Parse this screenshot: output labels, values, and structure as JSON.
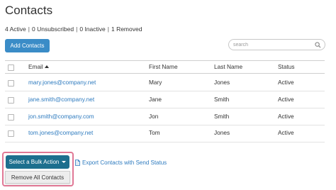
{
  "page": {
    "title": "Contacts"
  },
  "summary": [
    {
      "count": "4",
      "label": "Active"
    },
    {
      "count": "0",
      "label": "Unsubscribed"
    },
    {
      "count": "0",
      "label": "Inactive"
    },
    {
      "count": "1",
      "label": "Removed"
    }
  ],
  "toolbar": {
    "add_label": "Add Contacts",
    "search_placeholder": "search",
    "search_icon": "search-icon"
  },
  "table": {
    "headers": {
      "email": "Email",
      "first_name": "First Name",
      "last_name": "Last Name",
      "status": "Status"
    },
    "sort": {
      "column": "email",
      "direction": "ascending"
    },
    "rows": [
      {
        "email": "mary.jones@company.net",
        "first_name": "Mary",
        "last_name": "Jones",
        "status": "Active"
      },
      {
        "email": "jane.smith@company.net",
        "first_name": "Jane",
        "last_name": "Smith",
        "status": "Active"
      },
      {
        "email": "jon.smith@company.com",
        "first_name": "Jon",
        "last_name": "Smith",
        "status": "Active"
      },
      {
        "email": "tom.jones@company.net",
        "first_name": "Tom",
        "last_name": "Jones",
        "status": "Active"
      }
    ]
  },
  "bulk": {
    "button_label": "Select a Bulk Action",
    "menu_items": [
      "Remove All Contacts"
    ],
    "export_label": "Export Contacts with Send Status"
  },
  "colors": {
    "primary_button": "#3a8cc7",
    "bulk_button": "#1d6f8e",
    "link": "#2e7bbf",
    "highlight_frame": "#e07895"
  }
}
